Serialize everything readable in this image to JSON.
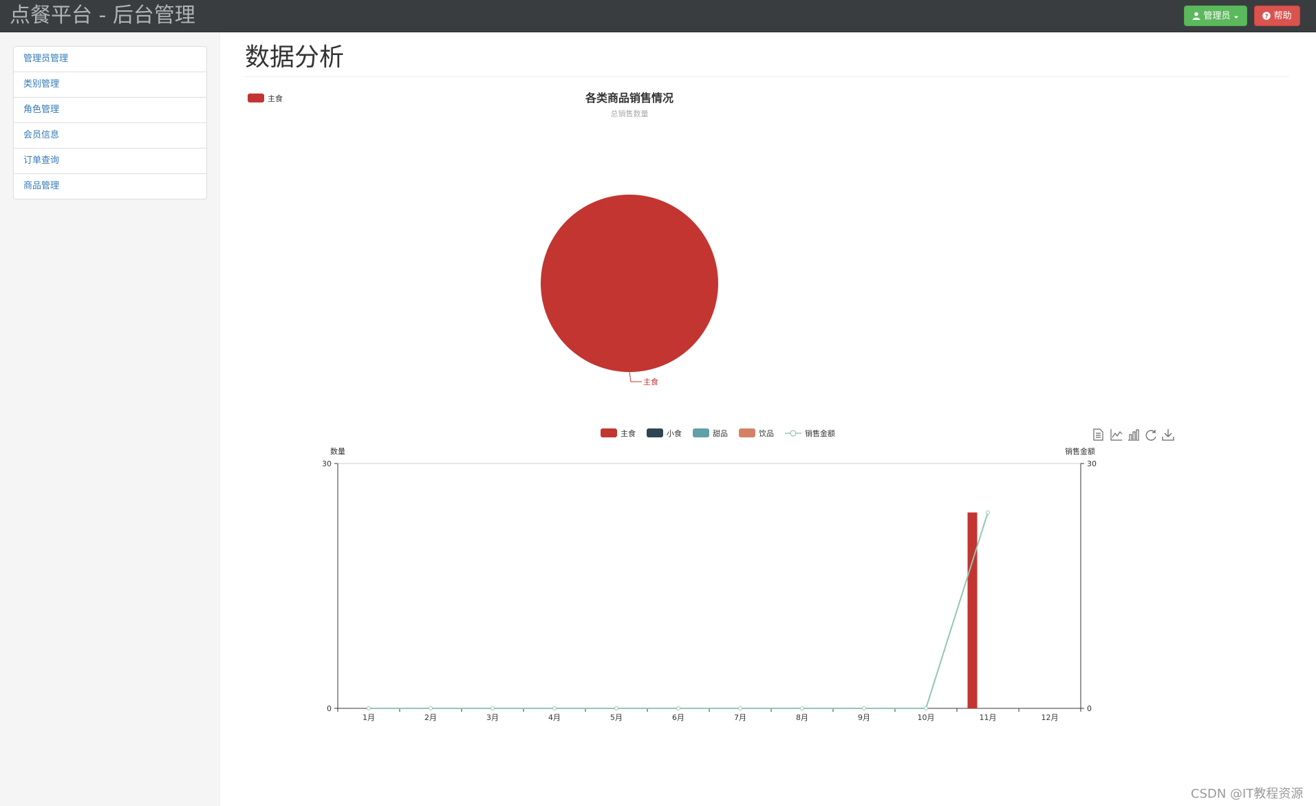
{
  "header": {
    "brand": "点餐平台 - 后台管理",
    "admin_button": "管理员",
    "help_button": "帮助"
  },
  "sidebar": {
    "items": [
      {
        "label": "管理员管理"
      },
      {
        "label": "类别管理"
      },
      {
        "label": "角色管理"
      },
      {
        "label": "会员信息"
      },
      {
        "label": "订单查询"
      },
      {
        "label": "商品管理"
      }
    ]
  },
  "main": {
    "title": "数据分析"
  },
  "chart_data": [
    {
      "type": "pie",
      "title": "各类商品销售情况",
      "subtitle": "总销售数量",
      "legend": [
        "主食"
      ],
      "legend_position": "top-left",
      "slices": [
        {
          "name": "主食",
          "value": 100,
          "color": "#c23531"
        }
      ]
    },
    {
      "type": "bar",
      "categories": [
        "1月",
        "2月",
        "3月",
        "4月",
        "5月",
        "6月",
        "7月",
        "8月",
        "9月",
        "10月",
        "11月",
        "12月"
      ],
      "series": [
        {
          "name": "主食",
          "type": "bar",
          "color": "#c23531",
          "values": [
            0,
            0,
            0,
            0,
            0,
            0,
            0,
            0,
            0,
            0,
            24,
            0
          ]
        },
        {
          "name": "小食",
          "type": "bar",
          "color": "#2f4554",
          "values": [
            0,
            0,
            0,
            0,
            0,
            0,
            0,
            0,
            0,
            0,
            0,
            0
          ]
        },
        {
          "name": "甜品",
          "type": "bar",
          "color": "#61a0a8",
          "values": [
            0,
            0,
            0,
            0,
            0,
            0,
            0,
            0,
            0,
            0,
            0,
            0
          ]
        },
        {
          "name": "饮品",
          "type": "bar",
          "color": "#d48265",
          "values": [
            0,
            0,
            0,
            0,
            0,
            0,
            0,
            0,
            0,
            0,
            0,
            0
          ]
        },
        {
          "name": "销售金额",
          "type": "line",
          "color": "#91c7ae",
          "axis": "right",
          "values": [
            0,
            0,
            0,
            0,
            0,
            0,
            0,
            0,
            0,
            0,
            24,
            null
          ]
        }
      ],
      "ylabel_left": "数量",
      "ylabel_right": "销售金额",
      "ylim_left": [
        0,
        30
      ],
      "ylim_right": [
        0,
        30
      ],
      "legend_position": "top-center",
      "grid": false,
      "toolbox_icons": [
        "data-view-icon",
        "line-chart-icon",
        "bar-chart-icon",
        "restore-icon",
        "save-image-icon"
      ]
    }
  ],
  "watermark": "CSDN @IT教程资源"
}
